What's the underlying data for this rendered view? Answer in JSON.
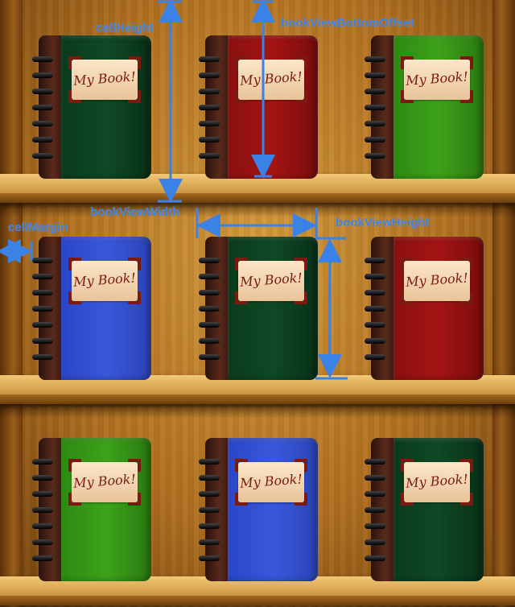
{
  "book_label": "My Book!",
  "labels": {
    "cell_height": "cellHeight",
    "book_view_bottom_offset": "bookViewBottomOffset",
    "book_view_width": "bookViewWidth",
    "cell_margin": "cellMargin",
    "book_view_height": "bookViewHeight"
  },
  "rows": [
    {
      "books": [
        {
          "color": "darkgreen"
        },
        {
          "color": "red"
        },
        {
          "color": "green"
        }
      ]
    },
    {
      "books": [
        {
          "color": "blue"
        },
        {
          "color": "darkgreen"
        },
        {
          "color": "red"
        }
      ]
    },
    {
      "books": [
        {
          "color": "green"
        },
        {
          "color": "blue"
        },
        {
          "color": "darkgreen"
        }
      ]
    }
  ],
  "colors": {
    "annotation": "#3b82e6"
  }
}
